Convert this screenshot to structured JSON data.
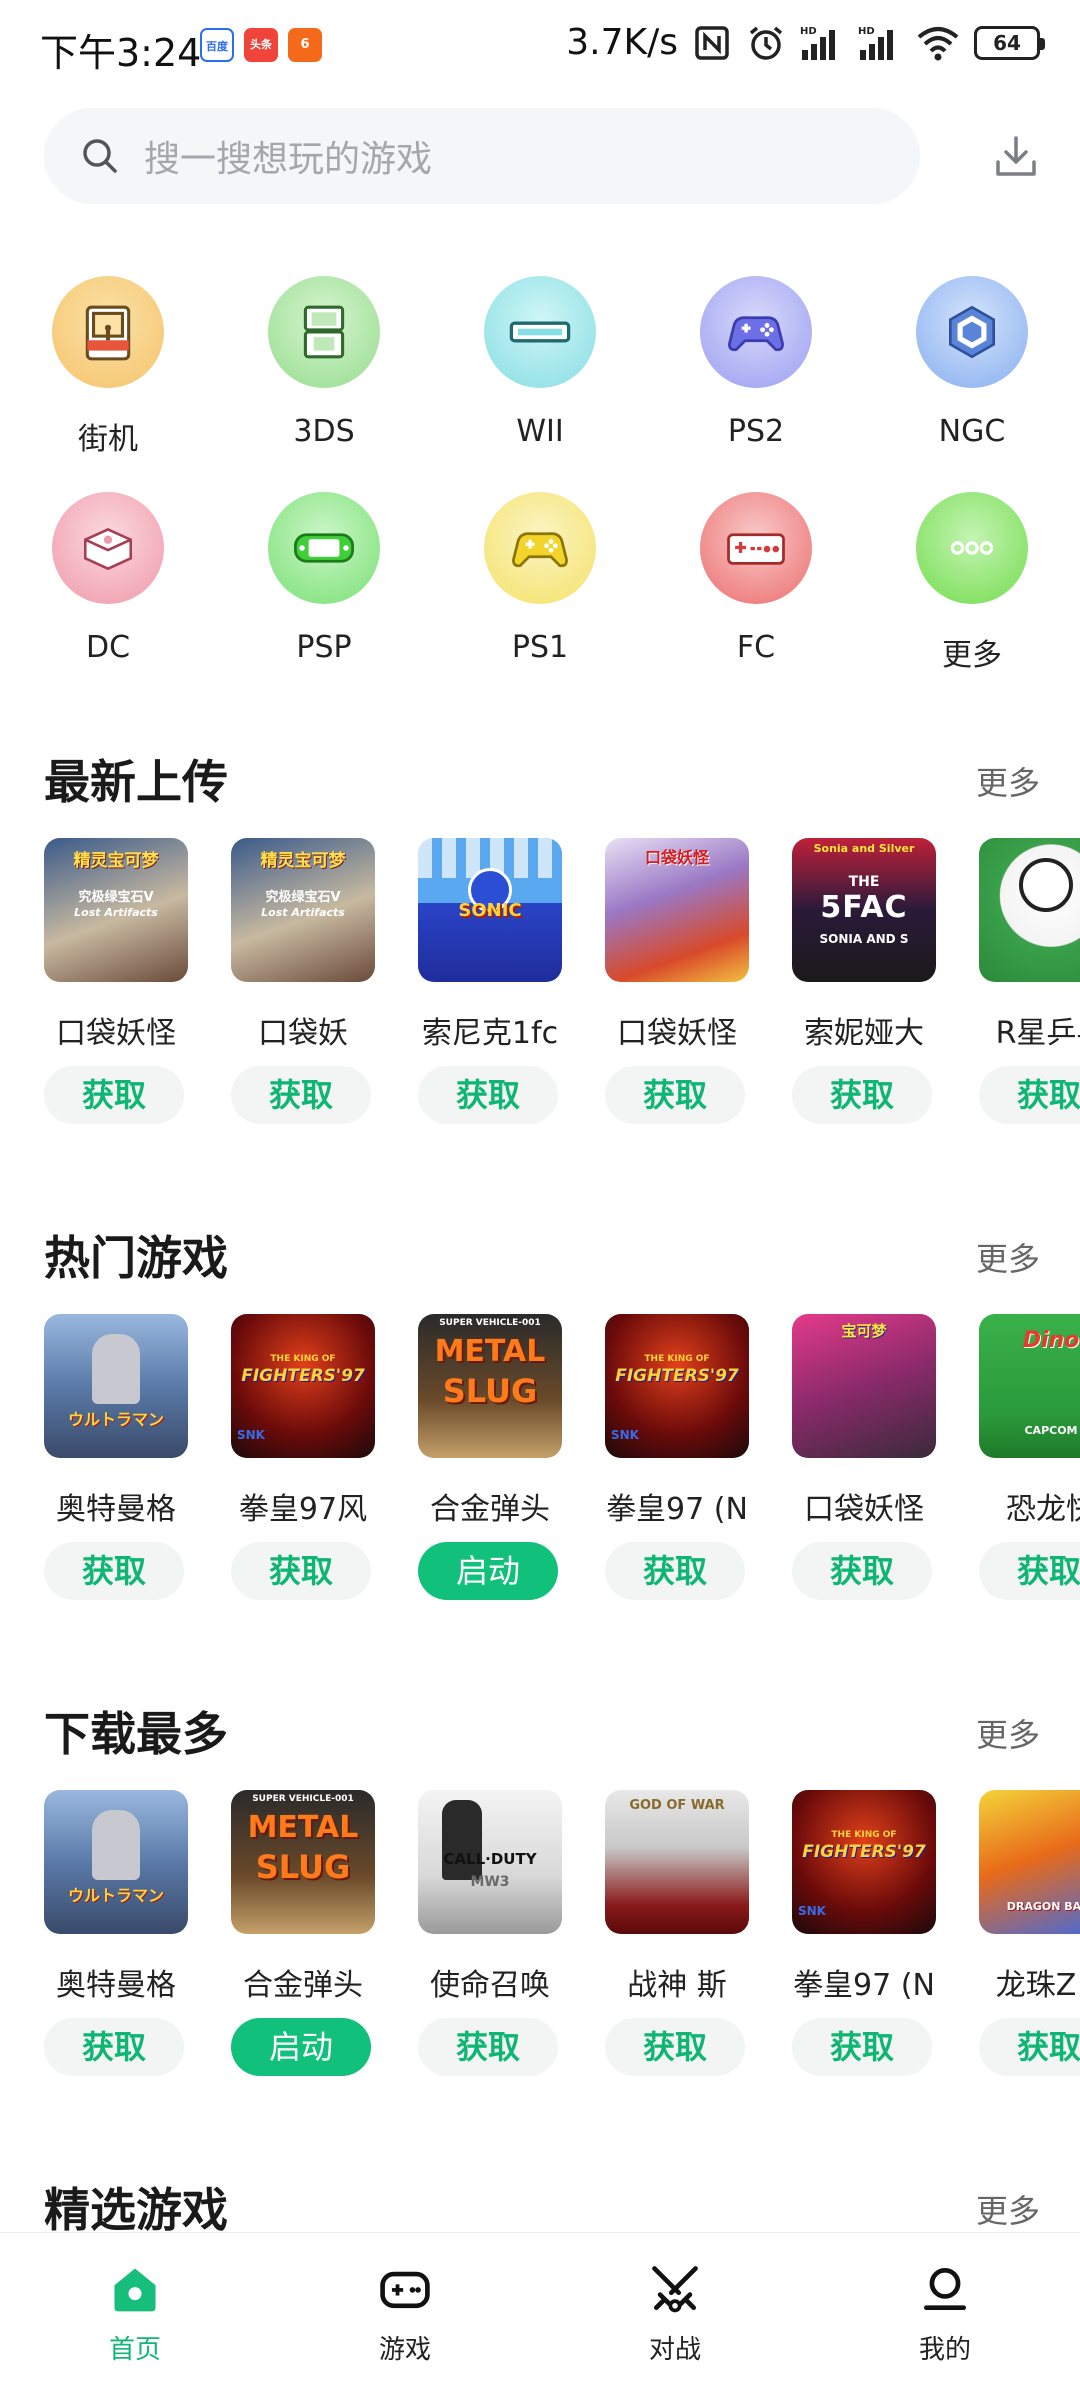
{
  "status_bar": {
    "time": "下午3:24",
    "apps": [
      "百度",
      "头条",
      "6"
    ],
    "net_speed": "3.7K/s",
    "signal_1_label": "HD",
    "signal_2_label": "HD",
    "battery": "64"
  },
  "search": {
    "placeholder": "搜一搜想玩的游戏",
    "icon": "search-icon",
    "download_icon": "download-icon"
  },
  "platforms": [
    {
      "label": "街机",
      "icon": "arcade-icon",
      "color": "#f5c76b"
    },
    {
      "label": "3DS",
      "icon": "3ds-icon",
      "color": "#8fd88a"
    },
    {
      "label": "WII",
      "icon": "wii-icon",
      "color": "#7fdde0"
    },
    {
      "label": "PS2",
      "icon": "ps2-gamepad-icon",
      "color": "#8b8ff0"
    },
    {
      "label": "NGC",
      "icon": "gamecube-icon",
      "color": "#7fa9ef"
    },
    {
      "label": "DC",
      "icon": "dreamcast-icon",
      "color": "#ef8fa1"
    },
    {
      "label": "PSP",
      "icon": "psp-icon",
      "color": "#6fe06b"
    },
    {
      "label": "PS1",
      "icon": "ps1-gamepad-icon",
      "color": "#f5e15b"
    },
    {
      "label": "FC",
      "icon": "fc-controller-icon",
      "color": "#ee6a6a"
    },
    {
      "label": "更多",
      "icon": "more-icon",
      "color": "#77df53"
    }
  ],
  "sections": [
    {
      "title": "最新上传",
      "more": "更多",
      "games": [
        {
          "name": "口袋妖怪",
          "button": "获取",
          "primary": false
        },
        {
          "name": "口袋妖",
          "button": "获取",
          "primary": false
        },
        {
          "name": "索尼克1fc",
          "button": "获取",
          "primary": false
        },
        {
          "name": "口袋妖怪",
          "button": "获取",
          "primary": false
        },
        {
          "name": "索妮娅大",
          "button": "获取",
          "primary": false
        },
        {
          "name": "R星乒乓",
          "button": "获取",
          "primary": false
        }
      ]
    },
    {
      "title": "热门游戏",
      "more": "更多",
      "games": [
        {
          "name": "奥特曼格",
          "button": "获取",
          "primary": false
        },
        {
          "name": "拳皇97风",
          "button": "获取",
          "primary": false
        },
        {
          "name": "合金弹头",
          "button": "启动",
          "primary": true
        },
        {
          "name": "拳皇97 (N",
          "button": "获取",
          "primary": false
        },
        {
          "name": "口袋妖怪",
          "button": "获取",
          "primary": false
        },
        {
          "name": "恐龙快",
          "button": "获取",
          "primary": false
        }
      ]
    },
    {
      "title": "下载最多",
      "more": "更多",
      "games": [
        {
          "name": "奥特曼格",
          "button": "获取",
          "primary": false
        },
        {
          "name": "合金弹头",
          "button": "启动",
          "primary": true
        },
        {
          "name": "使命召唤",
          "button": "获取",
          "primary": false
        },
        {
          "name": "战神 斯",
          "button": "获取",
          "primary": false
        },
        {
          "name": "拳皇97 (N",
          "button": "获取",
          "primary": false
        },
        {
          "name": "龙珠Z电",
          "button": "获取",
          "primary": false
        }
      ]
    },
    {
      "title": "精选游戏",
      "more": "更多",
      "games": []
    }
  ],
  "covers": {
    "pokemon_title": "精灵宝可梦",
    "pokemon_sub": "究极绿宝石V",
    "pokemon_sub2": "Lost Artifacts",
    "sonic": "SONIC",
    "pokemon_red": "口袋妖怪",
    "sonia_top": "Sonia and Silver",
    "sonia_big": "THE",
    "sonia_fac": "5FAC",
    "sonia_bottom": "SONIA AND S",
    "ultraman": "ウルトラマン",
    "kof_top": "THE KING OF",
    "kof_main": "FIGHTERS'97",
    "snk": "SNK",
    "ms_top": "SUPER VEHICLE-001",
    "ms_1": "METAL",
    "ms_2": "SLUG",
    "pokemon_cn": "宝可梦",
    "dino": "Dino",
    "capcom": "CAPCOM",
    "cod": "CALL·DUTY",
    "mw3": "MW3",
    "gow": "GOD OF WAR",
    "dbz": "DRAGON BALL"
  },
  "tabs": [
    {
      "label": "首页",
      "icon": "home-icon",
      "active": true
    },
    {
      "label": "游戏",
      "icon": "gamepad-icon",
      "active": false
    },
    {
      "label": "对战",
      "icon": "battle-swords-icon",
      "active": false
    },
    {
      "label": "我的",
      "icon": "profile-icon",
      "active": false
    }
  ],
  "colors": {
    "accent": "#11c07b",
    "button_bg": "#f3f5f4",
    "button_text": "#0fb573"
  }
}
